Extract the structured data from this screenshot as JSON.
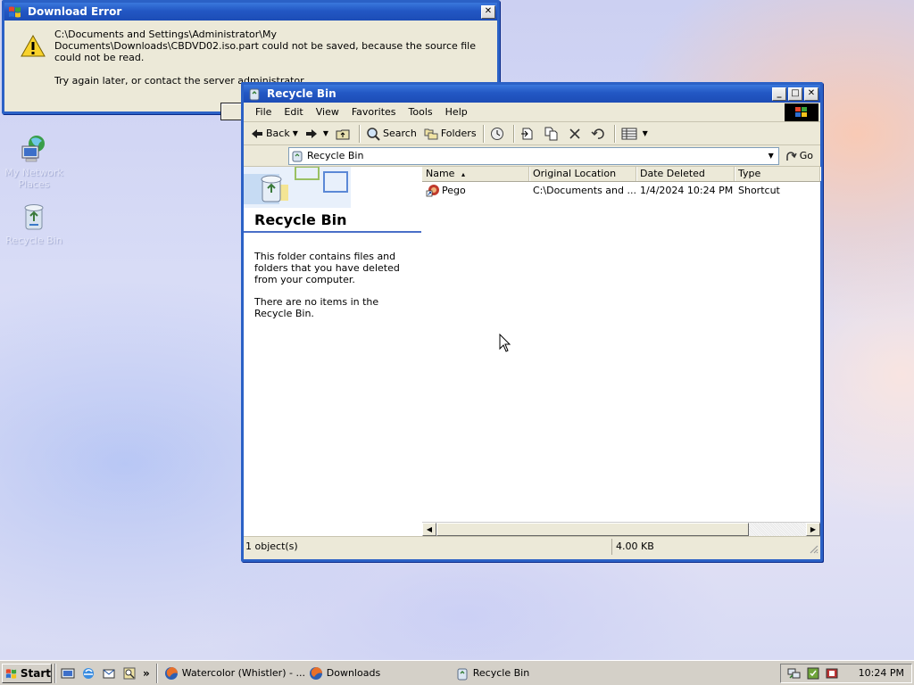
{
  "desktop": {
    "icons": [
      {
        "label": "My Network Places",
        "icon": "network-computer-icon"
      },
      {
        "label": "Recycle Bin",
        "icon": "recycle-bin-icon"
      }
    ]
  },
  "error_dialog": {
    "title": "Download Error",
    "message_line1": "C:\\Documents and Settings\\Administrator\\My Documents\\Downloads\\CBDVD02.iso.part could not be saved, because the source file could not be read.",
    "message_line2": "Try again later, or contact the server administrator.",
    "close_label": "✕",
    "icon": "warning-icon"
  },
  "window": {
    "title": "Recycle Bin",
    "controls": {
      "minimize": "_",
      "maximize": "□",
      "close": "✕"
    },
    "menu": [
      "File",
      "Edit",
      "View",
      "Favorites",
      "Tools",
      "Help"
    ],
    "toolbar": {
      "back": "Back",
      "search": "Search",
      "folders": "Folders"
    },
    "address": {
      "label": "",
      "value": "Recycle Bin",
      "go": "Go"
    },
    "left_pane": {
      "title": "Recycle Bin",
      "text1": "This folder contains files and folders that you have deleted from your computer.",
      "text2": "There are no items in the Recycle Bin."
    },
    "columns": [
      "Name",
      "Original Location",
      "Date Deleted",
      "Type"
    ],
    "sort_indicator": "▴",
    "rows": [
      {
        "name": "Pego",
        "location": "C:\\Documents and ...",
        "date": "1/4/2024 10:24 PM",
        "type": "Shortcut"
      }
    ],
    "status": {
      "count": "1 object(s)",
      "size": "4.00 KB"
    }
  },
  "taskbar": {
    "start": "Start",
    "more": "»",
    "tasks": [
      {
        "label": "Watercolor (Whistler) - ...",
        "icon": "firefox-icon"
      },
      {
        "label": "Downloads",
        "icon": "firefox-icon"
      },
      {
        "label": "Recycle Bin",
        "icon": "recycle-bin-icon"
      }
    ],
    "clock": "10:24 PM"
  },
  "colors": {
    "title_bar": "#2358c4",
    "window_face": "#ece9d8",
    "accent_rule": "#4a6fc8"
  }
}
